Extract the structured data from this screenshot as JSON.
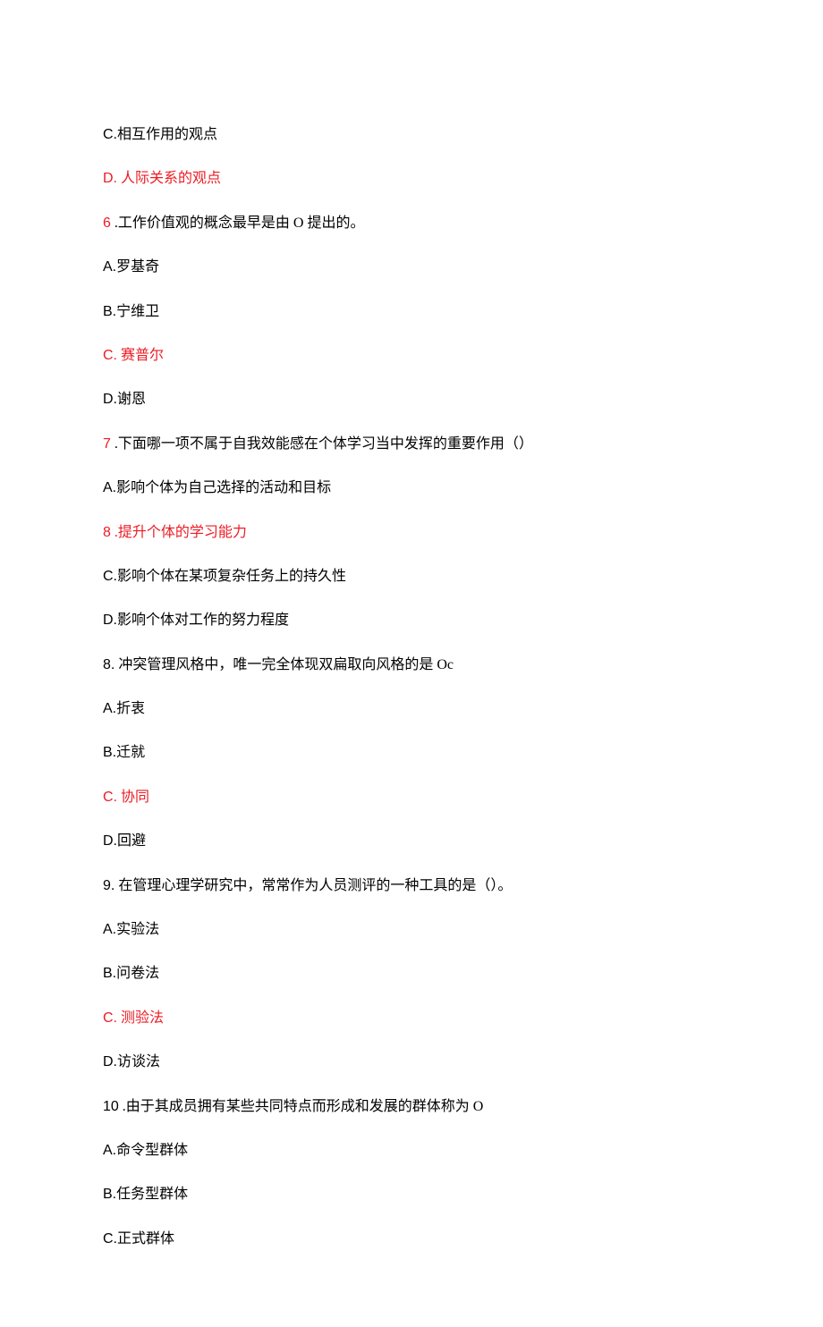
{
  "lines": [
    {
      "prefix": "C.",
      "text": "相互作用的观点",
      "highlighted": false
    },
    {
      "prefix": "D.",
      "text": "人际关系的观点",
      "highlighted": true,
      "space_after_prefix": true
    },
    {
      "prefix": "6",
      "text": " .工作价值观的概念最早是由 O 提出的。",
      "highlighted_prefix": true
    },
    {
      "prefix": "A.",
      "text": "罗基奇",
      "highlighted": false
    },
    {
      "prefix": "B.",
      "text": "宁维卫",
      "highlighted": false
    },
    {
      "prefix": "C.",
      "text": "赛普尔",
      "highlighted": true,
      "space_after_prefix": true
    },
    {
      "prefix": "D.",
      "text": "谢恩",
      "highlighted": false
    },
    {
      "prefix": "7",
      "text": " .下面哪一项不属于自我效能感在个体学习当中发挥的重要作用（）",
      "highlighted_prefix": true
    },
    {
      "prefix": "A.",
      "text": "影响个体为自己选择的活动和目标",
      "highlighted": false
    },
    {
      "prefix": "8",
      "text": " .提升个体的学习能力",
      "highlighted": true,
      "highlighted_prefix": true
    },
    {
      "prefix": "C.",
      "text": "影响个体在某项复杂任务上的持久性",
      "highlighted": false
    },
    {
      "prefix": "D.",
      "text": "影响个体对工作的努力程度",
      "highlighted": false
    },
    {
      "prefix": "8.",
      "text": " 冲突管理风格中，唯一完全体现双扁取向风格的是 Oc",
      "highlighted": false
    },
    {
      "prefix": "A.",
      "text": "折衷",
      "highlighted": false
    },
    {
      "prefix": "B.",
      "text": "迁就",
      "highlighted": false
    },
    {
      "prefix": "C.",
      "text": "协同",
      "highlighted": true,
      "space_after_prefix": true
    },
    {
      "prefix": "D.",
      "text": "回避",
      "highlighted": false
    },
    {
      "prefix": "9.",
      "text": " 在管理心理学研究中，常常作为人员测评的一种工具的是（）。",
      "highlighted": false
    },
    {
      "prefix": "A.",
      "text": "实验法",
      "highlighted": false
    },
    {
      "prefix": "B.",
      "text": "问卷法",
      "highlighted": false
    },
    {
      "prefix": "C.",
      "text": "测验法",
      "highlighted": true,
      "space_after_prefix": true
    },
    {
      "prefix": "D.",
      "text": "访谈法",
      "highlighted": false
    },
    {
      "prefix": "10",
      "text": " .由于其成员拥有某些共同特点而形成和发展的群体称为 O",
      "highlighted": false
    },
    {
      "prefix": "A.",
      "text": "命令型群体",
      "highlighted": false
    },
    {
      "prefix": "B.",
      "text": "任务型群体",
      "highlighted": false
    },
    {
      "prefix": "C.",
      "text": "正式群体",
      "highlighted": false
    }
  ]
}
